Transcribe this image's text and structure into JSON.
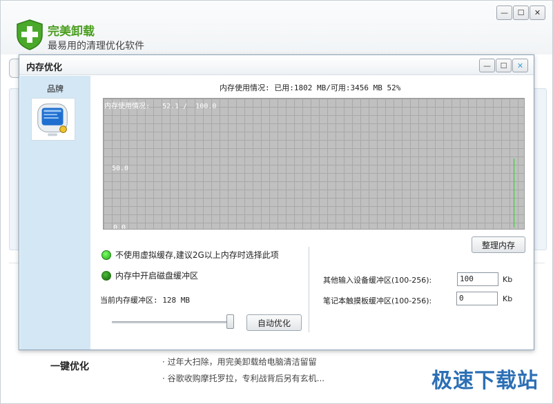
{
  "main": {
    "title": "完美卸载",
    "subtitle": "最易用的清理优化软件",
    "one_key_label": "一键优化",
    "news": [
      "· 过年大扫除，用完美卸载给电脑清洁留留",
      "· 谷歌收购摩托罗拉，专利战背后另有玄机..."
    ],
    "watermark": "极速下载站"
  },
  "dialog": {
    "title": "内存优化",
    "sidebar_label": "品牌",
    "usage_text": "内存使用情况: 已用:1802 MB/可用:3456 MB  52%",
    "graph": {
      "caption": "内存使用情况:",
      "current_value": "52.1",
      "max_value": "100.0",
      "tick_mid": "50.0",
      "tick_min": "0.0",
      "usage_percent": 52.1
    },
    "clean_button": "整理内存",
    "options": [
      "不使用虚拟缓存,建议2G以上内存时选择此项",
      "内存中开启磁盘缓冲区"
    ],
    "current_buffer": "当前内存缓冲区: 128 MB",
    "auto_button": "自动优化",
    "fields": [
      {
        "label": "其他输入设备缓冲区(100-256):",
        "value": "100",
        "unit": "Kb"
      },
      {
        "label": "笔记本触摸板缓冲区(100-256):",
        "value": "0",
        "unit": "Kb"
      }
    ]
  },
  "colors": {
    "accent_green": "#4a9e1e",
    "graph_line": "#1fd81f",
    "watermark_blue": "#2c6fb5"
  }
}
